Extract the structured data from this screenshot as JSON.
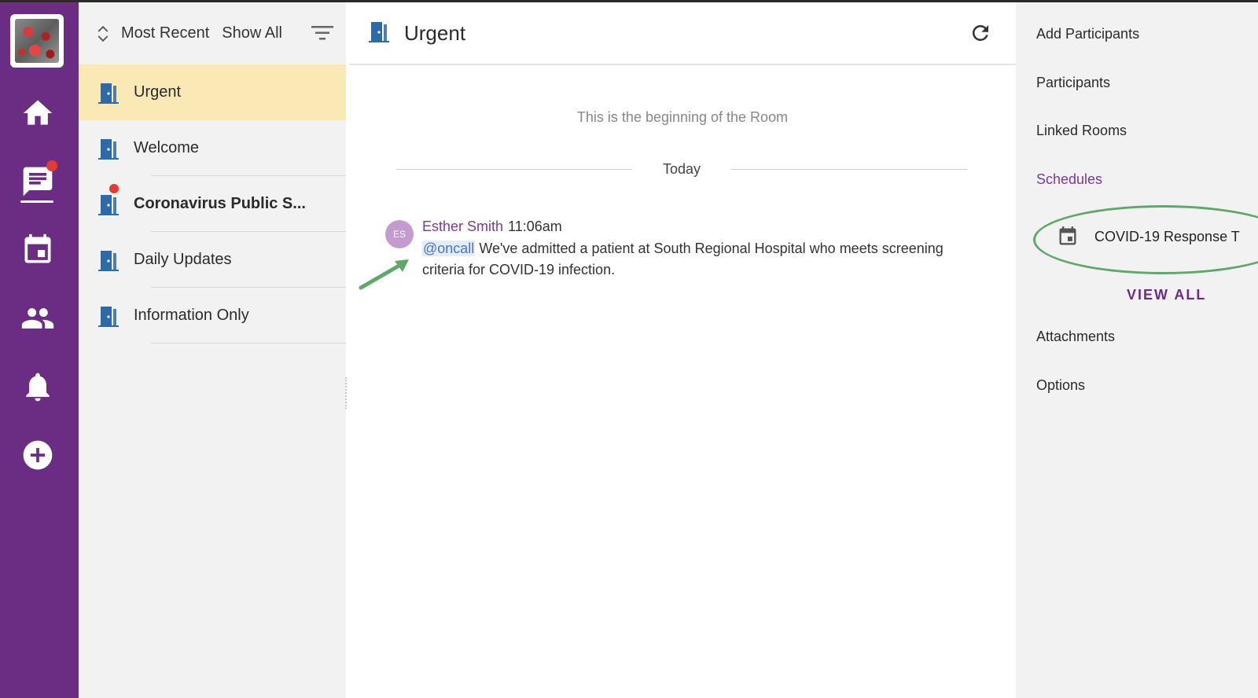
{
  "rail": {
    "items": [
      "home",
      "messages",
      "calendar",
      "people",
      "notifications",
      "add"
    ]
  },
  "rooms_panel": {
    "sort_label": "Most Recent",
    "filter_label": "Show All",
    "rooms": [
      {
        "name": "Urgent",
        "active": true,
        "unread": false
      },
      {
        "name": "Welcome",
        "active": false,
        "unread": false
      },
      {
        "name": "Coronavirus Public S...",
        "active": false,
        "unread": true
      },
      {
        "name": "Daily Updates",
        "active": false,
        "unread": false
      },
      {
        "name": "Information Only",
        "active": false,
        "unread": false
      }
    ]
  },
  "chat": {
    "title": "Urgent",
    "beginning_text": "This is the beginning of the Room",
    "date_divider": "Today",
    "message": {
      "avatar_initials": "ES",
      "author": "Esther Smith",
      "time": "11:06am",
      "mention": "@oncall",
      "text": " We've admitted a patient at South Regional Hospital who meets screening criteria for COVID-19 infection."
    }
  },
  "side_panel": {
    "add_participants": "Add Participants",
    "participants": "Participants",
    "linked_rooms": "Linked Rooms",
    "schedules": "Schedules",
    "schedule_item": "COVID-19 Response T",
    "view_all": "VIEW ALL",
    "attachments": "Attachments",
    "options": "Options"
  },
  "colors": {
    "rail": "#6b2d83",
    "active_room": "#fbe9b5",
    "accent": "#7b3a95",
    "door_icon": "#2e6aa6",
    "highlight_oval": "#5fa86a"
  }
}
